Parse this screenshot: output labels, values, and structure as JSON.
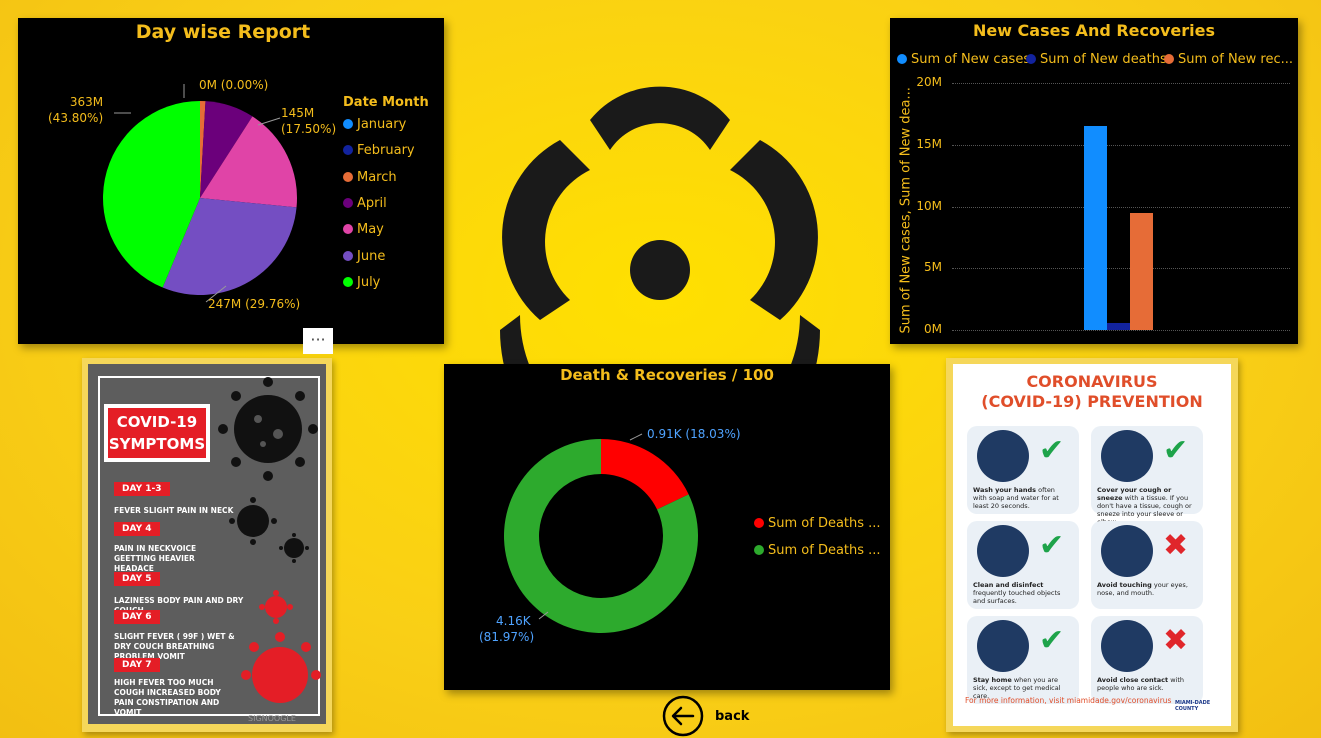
{
  "pie_panel": {
    "title": "Day wise Report",
    "legend_title": "Date Month",
    "labels": {
      "march": "0M (0.00%)",
      "may": "145M\n(17.50%)",
      "june": "247M (29.76%)",
      "july": "363M\n(43.80%)"
    }
  },
  "bar_panel": {
    "title": "New Cases And Recoveries",
    "yaxis_title": "Sum of New cases, Sum of New dea...",
    "legend": [
      "Sum of New cases",
      "Sum of New deaths",
      "Sum of New rec..."
    ]
  },
  "donut_panel": {
    "title": "Death & Recoveries / 100",
    "label_deaths": "0.91K (18.03%)",
    "label_recoveries_1": "4.16K",
    "label_recoveries_2": "(81.97%)",
    "legend": [
      "Sum of Deaths ...",
      "Sum of Deaths ..."
    ]
  },
  "more_button": "···",
  "back": {
    "label": "back",
    "icon": "arrow-left-circle-icon"
  },
  "symptoms_card": {
    "title_1": "COVID-19",
    "title_2": "SYMPTOMS",
    "days": [
      {
        "day": "DAY 1-3",
        "text": "FEVER SLIGHT PAIN IN NECK"
      },
      {
        "day": "DAY 4",
        "text": "PAIN IN NECKVOICE GEETTING HEAVIER HEADACE"
      },
      {
        "day": "DAY 5",
        "text": "LAZINESS  BODY PAIN AND DRY COUCH"
      },
      {
        "day": "DAY 6",
        "text": "SLIGHT FEVER ( 99F ) WET & DRY COUCH BREATHING PROBLEM VOMIT"
      },
      {
        "day": "DAY 7",
        "text": "HIGH FEVER TOO MUCH COUGH INCREASED BODY PAIN CONSTIPATION AND VOMIT"
      }
    ],
    "watermark": "SIGNOOGLE"
  },
  "prevention_card": {
    "title_1": "CORONAVIRUS",
    "title_2": "(COVID-19) PREVENTION",
    "tips": [
      {
        "bold": "Wash your hands",
        "rest": " often with soap and water for at least 20 seconds.",
        "ok": true
      },
      {
        "bold": "Cover your cough or sneeze",
        "rest": " with a tissue. If you don't have a tissue, cough or sneeze into your sleeve or elbow.",
        "ok": true
      },
      {
        "bold": "Clean and disinfect",
        "rest": " frequently touched objects and surfaces.",
        "ok": true
      },
      {
        "bold": "Avoid touching",
        "rest": " your eyes, nose, and mouth.",
        "ok": false
      },
      {
        "bold": "Stay home",
        "rest": " when you are sick, except to get medical care.",
        "ok": true
      },
      {
        "bold": "Avoid close contact",
        "rest": " with people who are sick.",
        "ok": false
      }
    ],
    "footer": "For more information, visit miamidade.gov/coronavirus",
    "logo": "MIAMI-DADE COUNTY"
  },
  "chart_data": [
    {
      "type": "pie",
      "title": "Day wise Report",
      "legend_title": "Date Month",
      "categories": [
        "January",
        "February",
        "March",
        "April",
        "May",
        "June",
        "July"
      ],
      "values": [
        0.0,
        0.0,
        7.5,
        68,
        145,
        247,
        363
      ],
      "percent": [
        0.0,
        0.0,
        0.9,
        8.04,
        17.5,
        29.76,
        43.8
      ],
      "colors": [
        "#118dff",
        "#12239e",
        "#e66c37",
        "#6b007b",
        "#e044a7",
        "#744ec2",
        "#00ff00"
      ],
      "legend_position": "right"
    },
    {
      "type": "bar",
      "title": "New Cases And Recoveries",
      "series": [
        {
          "name": "Sum of New cases",
          "values": [
            16.5
          ],
          "color": "#118dff"
        },
        {
          "name": "Sum of New deaths",
          "values": [
            0.6
          ],
          "color": "#12239e"
        },
        {
          "name": "Sum of New rec...",
          "values": [
            9.5
          ],
          "color": "#e66c37"
        }
      ],
      "ylim": [
        0,
        20
      ],
      "yticks": [
        "0M",
        "5M",
        "10M",
        "15M",
        "20M"
      ],
      "ylabel": "Sum of New cases, Sum of New dea...",
      "grid": true,
      "legend_position": "top"
    },
    {
      "type": "pie",
      "title": "Death & Recoveries / 100",
      "categories": [
        "Sum of Deaths ...",
        "Sum of Deaths ..."
      ],
      "values": [
        0.91,
        4.16
      ],
      "percent": [
        18.03,
        81.97
      ],
      "colors": [
        "#ff0000",
        "#2daa2d"
      ],
      "legend_position": "right"
    }
  ]
}
